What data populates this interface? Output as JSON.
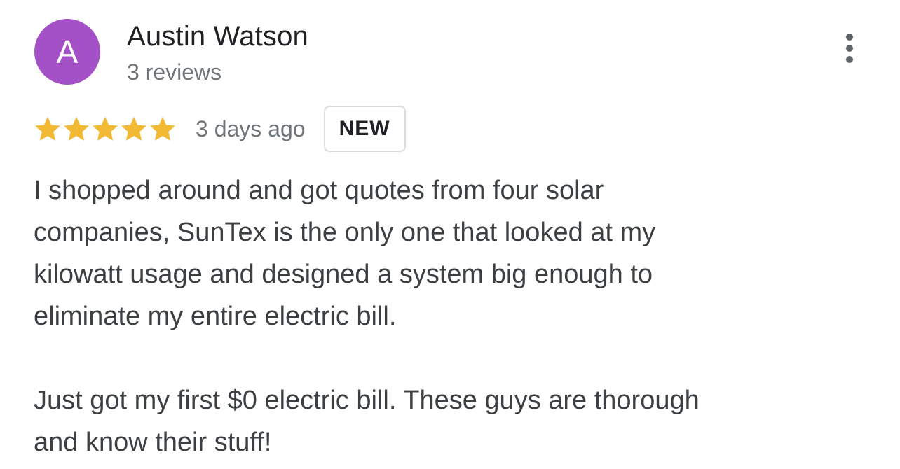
{
  "review": {
    "avatar_letter": "A",
    "avatar_color": "#a450c6",
    "author_name": "Austin Watson",
    "author_review_count": "3 reviews",
    "rating_stars": 5,
    "rating_max": 5,
    "star_color": "#f2b935",
    "date": "3 days ago",
    "badge": "NEW",
    "paragraph_1_lines": [
      "I shopped around and got quotes from four solar",
      "companies, SunTex is the only one that looked at my",
      "kilowatt usage and designed a system big enough to",
      "eliminate my entire electric bill."
    ],
    "paragraph_2_lines": [
      "Just got my first $0 electric bill. These guys are thorough",
      "and know their stuff!"
    ],
    "menu_icon": "more-vert-icon"
  }
}
